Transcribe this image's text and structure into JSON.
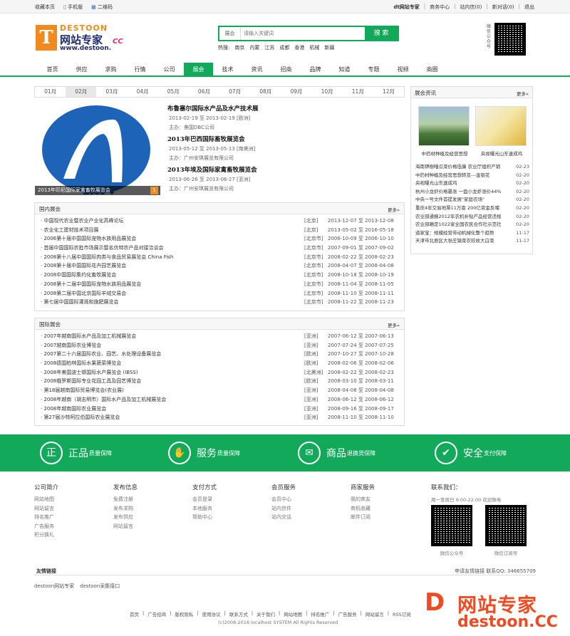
{
  "topbar": {
    "bookmark": "收藏本页",
    "mobile": "手机版",
    "qrcode": "二维码",
    "site_name": "dt网站专家",
    "right_links": [
      "商务中心",
      "站内信(0)",
      "新对话(0)",
      "退出"
    ]
  },
  "logo": {
    "brand_en": "DESTOON",
    "brand_cn": "网站专家",
    "url": "www.destoon.",
    "cc": "CC"
  },
  "search": {
    "category": "展会",
    "placeholder": "请输入关键词",
    "button": "搜 索",
    "hot_label": "热搜:",
    "hot_words": [
      "南京",
      "内蒙",
      "江苏",
      "成都",
      "香港",
      "机械",
      "新疆"
    ]
  },
  "qr_label": "微信公众号",
  "nav": [
    "首页",
    "供应",
    "求购",
    "行情",
    "公司",
    "展会",
    "技术",
    "资讯",
    "招商",
    "品牌",
    "知道",
    "专题",
    "视频",
    "商圈"
  ],
  "nav_active": 5,
  "months": [
    "01月",
    "02月",
    "03月",
    "04月",
    "05月",
    "06月",
    "07月",
    "08月",
    "09月",
    "10月",
    "11月",
    "12月"
  ],
  "month_active": 1,
  "featured": {
    "caption": "2013年印尼国际家禽畜牧展览会",
    "index": "1",
    "items": [
      {
        "title": "布鲁塞尔国际水产品及水产技术展",
        "date": "2013-02-19 至 2013-02-19 [欧洲]",
        "org": "主办：美国DBC公司"
      },
      {
        "title": "2013年巴西国际畜牧展览会",
        "date": "2013-05-12 至 2013-05-13 [南美洲]",
        "org": "主办：广州安琪展览有限公司"
      },
      {
        "title": "2013年埃及国际家禽畜牧展览会",
        "date": "2013-06-26 至 2013-06-27 [亚洲]",
        "org": "主办：广州安琪展览有限公司"
      }
    ]
  },
  "domestic": {
    "title": "国内展会",
    "more": "更多»",
    "rows": [
      {
        "name": "· 中国现代农业暨农业产业化高峰论坛",
        "city": "[北京]",
        "date": "2013-12-07 至 2013-12-08"
      },
      {
        "name": "· 农业化工建材技术项目展",
        "city": "[北京]",
        "date": "2013-05-02 至 2016-05-18"
      },
      {
        "name": "· 2006第十届中国国际宠物水族用品展览会",
        "city": "[北京市]",
        "date": "2006-10-09 至 2006-10-10"
      },
      {
        "name": "· 首届中国国际农批市场展示暨名优特农产品对接洽谈会",
        "city": "[北京市]",
        "date": "2007-09-01 至 2007-09-02"
      },
      {
        "name": "· 2008第十八届中国国际肉类与食品贸易展览会 China Fish",
        "city": "[北京市]",
        "date": "2008-02-22 至 2008-02-23"
      },
      {
        "name": "· 2008第十届中国国际花卉园艺展览会",
        "city": "[北京市]",
        "date": "2008-04-07 至 2008-04-08"
      },
      {
        "name": "· 2008中国国际集约化畜牧展览会",
        "city": "[北京市]",
        "date": "2008-10-18 至 2008-10-19"
      },
      {
        "name": "· 2008第十二届中国国际宠物水族用品展览会",
        "city": "[北京市]",
        "date": "2008-11-04 至 2008-11-05"
      },
      {
        "name": "· 2008第二届中国北京国际羊绒交易会",
        "city": "[北京市]",
        "date": "2008-11-10 至 2008-11-11"
      },
      {
        "name": "· 第七届中国国际灌溉和施肥展览会",
        "city": "[北京市]",
        "date": "2008-11-22 至 2008-11-23"
      }
    ]
  },
  "international": {
    "title": "国际展会",
    "more": "更多»",
    "rows": [
      {
        "name": "· 2007年越南国际水产品及加工机械展览会",
        "city": "[亚洲]",
        "date": "2007-06-12 至 2007-06-13"
      },
      {
        "name": "· 2007越南国际农业博览会",
        "city": "[亚洲]",
        "date": "2007-07-24 至 2007-07-25"
      },
      {
        "name": "· 2007第二十六届国际农业、园艺、水处理设备展览会",
        "city": "[欧洲]",
        "date": "2007-10-27 至 2007-10-28"
      },
      {
        "name": "· 2008德国柏林国际水果蔬菜博览会",
        "city": "[欧洲]",
        "date": "2008-02-06 至 2008-02-06"
      },
      {
        "name": "· 2008年美国波士顿国际水产展览会 (IBSS)",
        "city": "[北美洲]",
        "date": "2008-02-22 至 2008-02-23"
      },
      {
        "name": "· 2008俄罗斯国际专业花园工具及园艺博览会",
        "city": "[欧洲]",
        "date": "2008-03-10 至 2008-03-11"
      },
      {
        "name": "· 第18届越南国际贸易博览会(农业展)",
        "city": "[亚洲]",
        "date": "2008-04-08 至 2008-04-08"
      },
      {
        "name": "· 2008年越南（胡志明市）国际水产品及加工机械展览会",
        "city": "[亚洲]",
        "date": "2008-06-12 至 2008-06-12"
      },
      {
        "name": "· 2008年越南国际农业展览会",
        "city": "[亚洲]",
        "date": "2008-09-16 至 2008-09-17"
      },
      {
        "name": "· 第27届沙特阿拉伯国际农业展览会",
        "city": "[亚洲]",
        "date": "2008-11-10 至 2008-11-10"
      }
    ]
  },
  "side": {
    "title": "展会资讯",
    "more": "更多»",
    "pics": [
      "中药材种植及经营思想",
      "央视曝光山东速成鸡"
    ],
    "news": [
      {
        "t": "海南钾樹唾瓜菜价格低廉 农业厅组织产销",
        "d": "02-23"
      },
      {
        "t": "中药材种植及经营思想转变---金银花",
        "d": "02-20"
      },
      {
        "t": "央视曝光山东速成鸡",
        "d": "02-20"
      },
      {
        "t": "杭州小龙虾价格暴涨 一盘小龙虾涨价44%",
        "d": "02-20"
      },
      {
        "t": "中央一号文件首提发展\"家庭农场\"",
        "d": "02-20"
      },
      {
        "t": "重庆4年交易地票11万亩 200亿资金反哺",
        "d": "02-20"
      },
      {
        "t": "农业部通报2012年农机补贴产品经营违规",
        "d": "02-20"
      },
      {
        "t": "农业部确定1022家全国农民合作社示范社",
        "d": "02-20"
      },
      {
        "t": "道家宝：规模经营带动机械化整个趋势",
        "d": "11-17"
      },
      {
        "t": "天津市北辰区大张庄镇菜农较收大白菜",
        "d": "11-17"
      }
    ]
  },
  "guarantees": [
    {
      "icon": "正",
      "big": "正品",
      "small": "质量保障"
    },
    {
      "icon": "✋",
      "big": "服务",
      "small": "质量保障"
    },
    {
      "icon": "✉",
      "big": "商品",
      "small": "退换货保障"
    },
    {
      "icon": "✔",
      "big": "安全",
      "small": "支付保障"
    }
  ],
  "footer_cols": [
    {
      "h": "公司简介",
      "items": [
        "网站地图",
        "网站留言",
        "排名推广",
        "广告服务",
        "积分换礼"
      ]
    },
    {
      "h": "发布信息",
      "items": [
        "免费注册",
        "发布求购",
        "发布供应",
        "网站留言"
      ]
    },
    {
      "h": "支付方式",
      "items": [
        "会员登录",
        "本地服务",
        "帮助中心"
      ]
    },
    {
      "h": "会员服务",
      "items": [
        "会员中心",
        "站内信件",
        "站内交谈"
      ]
    },
    {
      "h": "商家服务",
      "items": [
        "我的商友",
        "商机收藏",
        "邮件订阅"
      ]
    }
  ],
  "contact": {
    "title": "联系我们：",
    "hours": "周一至周日 9:00-22:00 欢迎致电",
    "qr1": "微信公众号",
    "qr2": "微信订阅号"
  },
  "links": {
    "title": "友情链接",
    "right": "申请友情链接  联系QQ:  346655709",
    "friends": [
      "destoon网站专家",
      "destoon采集接口"
    ]
  },
  "bottom_nav": [
    "首页",
    "|",
    "广告招商",
    "|",
    "版权隐私",
    "|",
    "使用协议",
    "|",
    "联系方式",
    "|",
    "关于我们",
    "|",
    "网站地图",
    "|",
    "排名推广",
    "|",
    "广告服务",
    "|",
    "网站留言",
    "|",
    "RSS订阅"
  ],
  "copyright": "(c)2008-2016 localhost SYSTEM All Rights Reserved",
  "watermark": {
    "mark": "D",
    "cn": "网站专家",
    "en": "destoon.CC"
  },
  "colors": {
    "accent": "#12a95a",
    "brand_orange": "#f08a1c",
    "watermark": "#ef4b22"
  }
}
